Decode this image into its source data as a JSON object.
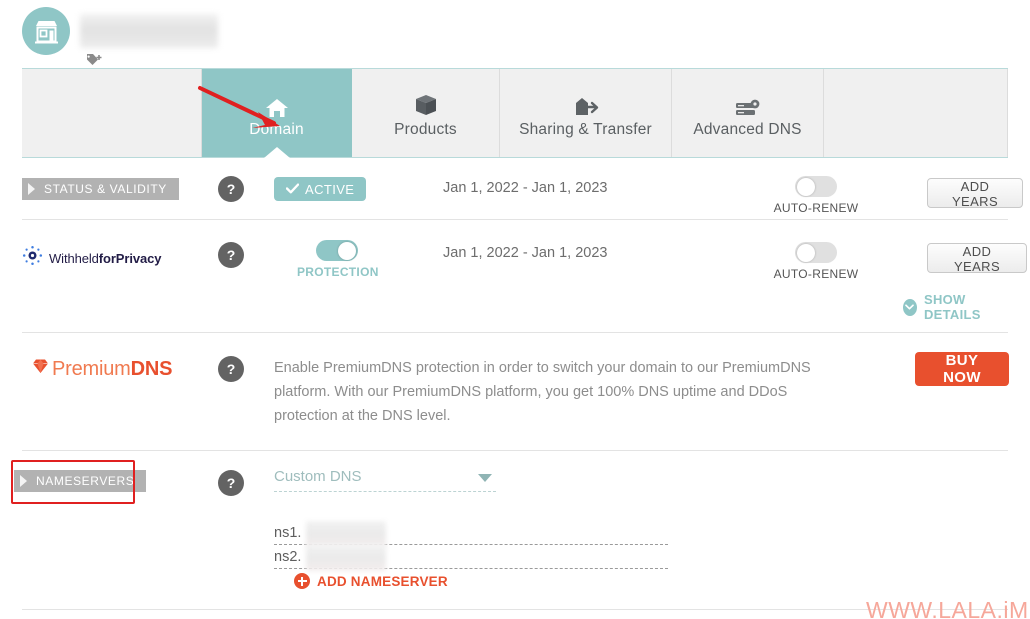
{
  "header": {
    "avatar_icon": "storefront-icon",
    "account_name": "",
    "tag_icon": "tag-plus-icon"
  },
  "tabs": [
    {
      "label": "Domain",
      "icon": "home-icon",
      "active": true
    },
    {
      "label": "Products",
      "icon": "box-icon",
      "active": false
    },
    {
      "label": "Sharing & Transfer",
      "icon": "share-arrow-icon",
      "active": false
    },
    {
      "label": "Advanced DNS",
      "icon": "dns-server-icon",
      "active": false
    }
  ],
  "annotation": {
    "arrow_color": "#e02020",
    "highlight_color": "#e02020"
  },
  "rows": {
    "status": {
      "ribbon_label": "STATUS & VALIDITY",
      "help_icon": "question-mark-icon",
      "status_badge": "ACTIVE",
      "check_icon": "check-icon",
      "date_range": "Jan 1, 2022 - Jan 1, 2023",
      "toggle_label": "AUTO-RENEW",
      "toggle_state": "off",
      "action_button": "ADD YEARS"
    },
    "privacy": {
      "logo_text_light": "Withheld",
      "logo_text_bold": "forPrivacy",
      "logo_icon": "privacy-burst-icon",
      "help_icon": "question-mark-icon",
      "toggle_label": "PROTECTION",
      "toggle_state": "on",
      "date_range": "Jan 1, 2022 - Jan 1, 2023",
      "autorenew_label": "AUTO-RENEW",
      "autorenew_state": "off",
      "action_button": "ADD YEARS",
      "show_details": "SHOW DETAILS",
      "show_details_icon": "chevron-down-icon"
    },
    "premiumdns": {
      "logo_gem_icon": "gem-icon",
      "logo_text_light": "Premium",
      "logo_text_bold": "DNS",
      "help_icon": "question-mark-icon",
      "description": "Enable PremiumDNS protection in order to switch your domain to our PremiumDNS platform. With our PremiumDNS platform, you get 100% DNS uptime and DDoS protection at the DNS level.",
      "buy_button": "BUY NOW"
    },
    "nameservers": {
      "ribbon_label": "NAMESERVERS",
      "help_icon": "question-mark-icon",
      "dns_select_value": "Custom DNS",
      "dns_select_caret": "caret-down-icon",
      "entries": [
        {
          "prefix": "ns1.",
          "value": ""
        },
        {
          "prefix": "ns2.",
          "value": ""
        }
      ],
      "add_label": "ADD NAMESERVER",
      "add_icon": "plus-circle-icon"
    }
  },
  "watermark": {
    "text": "WWW.LALA.iM",
    "color": "#f6a79a"
  },
  "colors": {
    "teal": "#8fc6c6",
    "orange": "#e8502e",
    "ribbon_gray": "#b2b2b2",
    "tab_bg": "#f0f0f0"
  }
}
